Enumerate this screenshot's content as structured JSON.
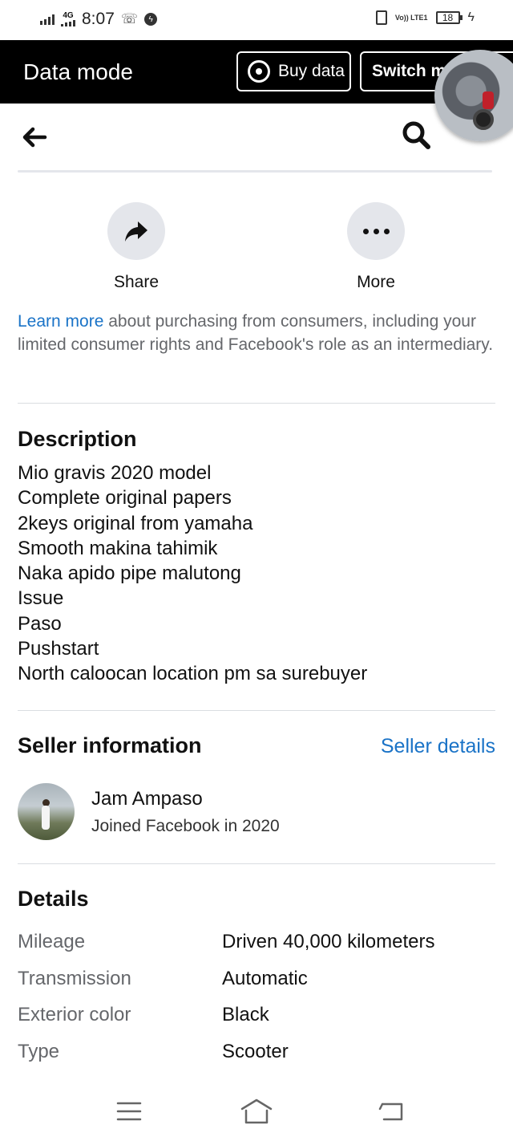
{
  "status_bar": {
    "network": "4G",
    "time": "8:07",
    "volte": "Vo)) LTE1",
    "battery": "18"
  },
  "data_mode": {
    "title": "Data mode",
    "buy_data_label": "Buy data",
    "switch_label": "Switch m"
  },
  "actions": {
    "share_label": "Share",
    "more_label": "More"
  },
  "learn_more": {
    "link": "Learn more",
    "text": " about purchasing from consumers, including your limited consumer rights and Facebook's role as an intermediary."
  },
  "description": {
    "title": "Description",
    "lines": [
      "Mio gravis 2020 model",
      "Complete original papers",
      "2keys original from yamaha",
      "Smooth makina tahimik",
      "Naka apido pipe malutong",
      "Issue",
      "Paso",
      "Pushstart",
      "North caloocan location pm sa surebuyer"
    ]
  },
  "seller": {
    "title": "Seller information",
    "details_link": "Seller details",
    "name": "Jam Ampaso",
    "joined": "Joined Facebook in 2020"
  },
  "details": {
    "title": "Details",
    "rows": [
      {
        "key": "Mileage",
        "value": "Driven 40,000 kilometers"
      },
      {
        "key": "Transmission",
        "value": "Automatic"
      },
      {
        "key": "Exterior color",
        "value": "Black"
      },
      {
        "key": "Type",
        "value": "Scooter"
      }
    ]
  },
  "colors": {
    "link": "#1a73c7",
    "muted_text": "#65676b",
    "circle_bg": "#e4e6eb",
    "data_mode_bg": "#000000"
  },
  "icons": {
    "back": "arrow-left-icon",
    "search": "search-icon",
    "share": "share-arrow-icon",
    "more": "more-dots-icon",
    "buy_data": "broadcast-icon",
    "nav_menu": "menu-icon",
    "nav_home": "home-icon",
    "nav_back": "back-icon"
  }
}
